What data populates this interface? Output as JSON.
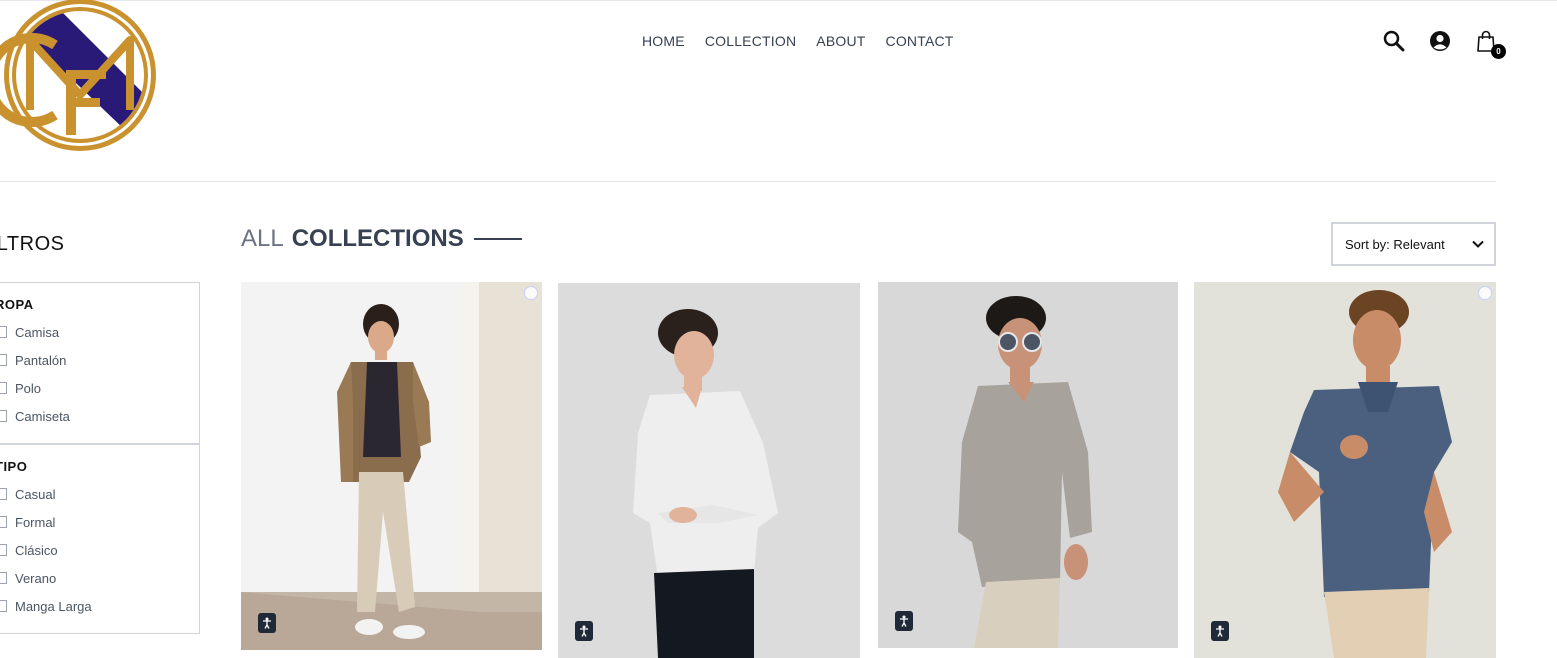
{
  "header": {
    "nav": [
      "HOME",
      "COLLECTION",
      "ABOUT",
      "CONTACT"
    ],
    "cart_count": "0",
    "icons": [
      "search-icon",
      "profile-icon",
      "cart-icon"
    ]
  },
  "filters": {
    "title": "FILTROS",
    "groups": [
      {
        "heading": "ROPA",
        "options": [
          "Camisa",
          "Pantalón",
          "Polo",
          "Camiseta"
        ]
      },
      {
        "heading": "TIPO",
        "options": [
          "Casual",
          "Formal",
          "Clásico",
          "Verano",
          "Manga Larga"
        ]
      }
    ]
  },
  "collection": {
    "title_light": "ALL",
    "title_bold": "COLLECTIONS",
    "sort_label": "Sort by: Relevant"
  },
  "products": [
    {
      "description": "plaid-shirt-beige-cargo"
    },
    {
      "description": "white-shirt-black-pants"
    },
    {
      "description": "grey-shirt-sunglasses"
    },
    {
      "description": "navy-polo-shirt"
    }
  ],
  "colors": {
    "logo_gold": "#c9922f",
    "logo_purple": "#2a1a78",
    "text_dark": "#374151"
  }
}
